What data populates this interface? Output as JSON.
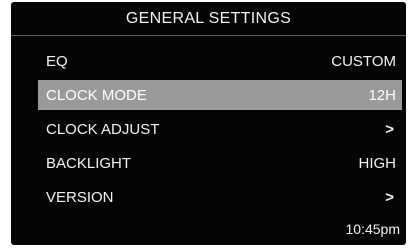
{
  "header": {
    "title": "GENERAL SETTINGS"
  },
  "menu": {
    "selected_index": 1,
    "items": [
      {
        "label": "EQ",
        "value": "CUSTOM"
      },
      {
        "label": "CLOCK MODE",
        "value": "12H"
      },
      {
        "label": "CLOCK ADJUST",
        "value": ">"
      },
      {
        "label": "BACKLIGHT",
        "value": "HIGH"
      },
      {
        "label": "VERSION",
        "value": ">"
      }
    ]
  },
  "status": {
    "time": "10:45pm"
  },
  "colors": {
    "background": "#050505",
    "text": "#f2f2f2",
    "highlight": "#9a9a9a"
  }
}
